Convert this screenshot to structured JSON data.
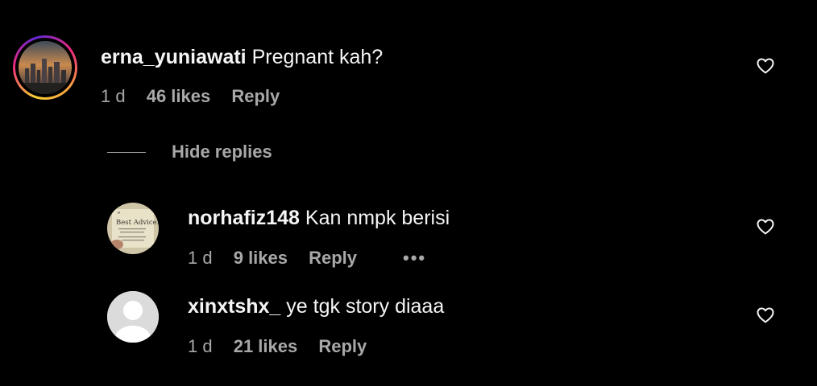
{
  "comments": [
    {
      "username": "erna_yuniawati",
      "text": "Pregnant kah?",
      "time": "1 d",
      "likes": "46 likes",
      "reply_label": "Reply"
    }
  ],
  "hide_replies_label": "Hide replies",
  "replies": [
    {
      "username": "norhafiz148",
      "text": "Kan nmpk berisi",
      "time": "1 d",
      "likes": "9 likes",
      "reply_label": "Reply",
      "more_label": "•••",
      "avatar_text": "Best Advice"
    },
    {
      "username": "xinxtshx_",
      "text": "ye tgk story diaaa",
      "time": "1 d",
      "likes": "21 likes",
      "reply_label": "Reply"
    }
  ],
  "icons": {
    "like": "heart-outline-icon",
    "more": "more-horizontal-icon"
  },
  "colors": {
    "background": "#000000",
    "text": "#f5f5f5",
    "secondary": "#a8a8a8"
  }
}
